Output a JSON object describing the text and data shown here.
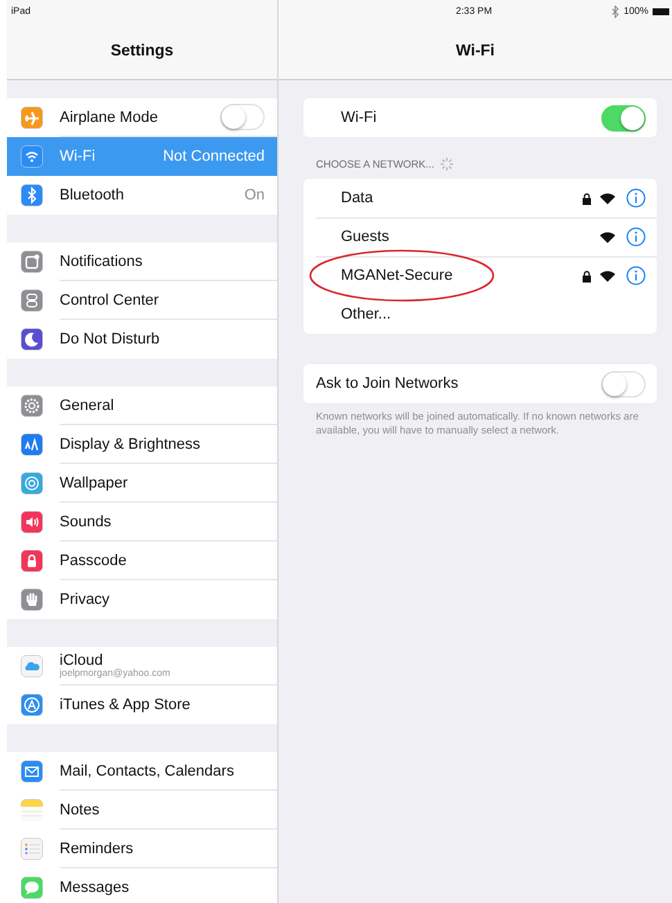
{
  "status_bar": {
    "device": "iPad",
    "time": "2:33 PM",
    "battery": "100%"
  },
  "sidebar": {
    "title": "Settings",
    "groups": [
      {
        "items": [
          {
            "label": "Airplane Mode",
            "color": "#f7981c",
            "selected": false,
            "toggle": {
              "on": false
            }
          },
          {
            "label": "Wi-Fi",
            "color": "#2b8cf5",
            "selected": true,
            "value": "Not Connected"
          },
          {
            "label": "Bluetooth",
            "color": "#2b8cf5",
            "selected": false,
            "value": "On"
          }
        ]
      },
      {
        "items": [
          {
            "label": "Notifications",
            "color": "#8e8e93",
            "selected": false
          },
          {
            "label": "Control Center",
            "color": "#8e8e93",
            "selected": false
          },
          {
            "label": "Do Not Disturb",
            "color": "#5a4fd0",
            "selected": false
          }
        ]
      },
      {
        "items": [
          {
            "label": "General",
            "color": "#8e8e93",
            "selected": false
          },
          {
            "label": "Display & Brightness",
            "color": "#1e7cf2",
            "selected": false
          },
          {
            "label": "Wallpaper",
            "color": "#35aadc",
            "selected": false
          },
          {
            "label": "Sounds",
            "color": "#f2355b",
            "selected": false
          },
          {
            "label": "Passcode",
            "color": "#f2355b",
            "selected": false
          },
          {
            "label": "Privacy",
            "color": "#8e8e93",
            "selected": false
          }
        ]
      },
      {
        "items": [
          {
            "label": "iCloud",
            "subtitle": "joelpmorgan@yahoo.com",
            "color": "#f4f4f6",
            "selected": false
          },
          {
            "label": "iTunes & App Store",
            "color": "#2d8ef0",
            "selected": false
          }
        ]
      },
      {
        "items": [
          {
            "label": "Mail, Contacts, Calendars",
            "color": "#2a8df3",
            "selected": false
          },
          {
            "label": "Notes",
            "color": "#fbd54a",
            "selected": false
          },
          {
            "label": "Reminders",
            "color": "#f4f4f4",
            "selected": false
          },
          {
            "label": "Messages",
            "color": "#4cd964",
            "selected": false
          }
        ]
      }
    ]
  },
  "detail": {
    "title": "Wi-Fi",
    "wifi": {
      "label": "Wi-Fi",
      "on": true
    },
    "networks_header": "CHOOSE A NETWORK...",
    "networks": [
      {
        "name": "Data",
        "locked": true,
        "circled": false
      },
      {
        "name": "Guests",
        "locked": false,
        "circled": false
      },
      {
        "name": "MGANet-Secure",
        "locked": true,
        "circled": true
      }
    ],
    "other": "Other...",
    "ask_to_join": {
      "label": "Ask to Join Networks",
      "on": false
    },
    "footnote": "Known networks will be joined automatically. If no known networks are available, you will have to manually select a network."
  }
}
